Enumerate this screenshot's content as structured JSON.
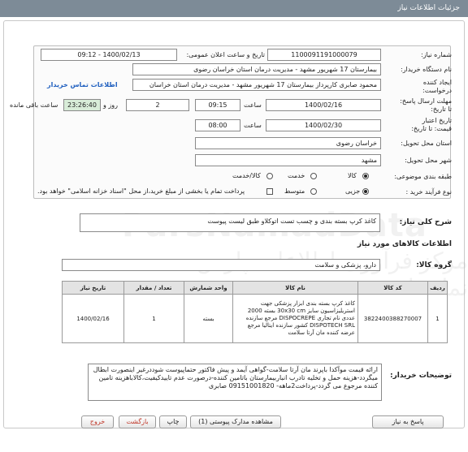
{
  "window": {
    "title": "جزئیات اطلاعات نیاز"
  },
  "header": {
    "need_number_label": "شماره نیاز:",
    "need_number": "1100091191000079",
    "announce_label": "تاریخ و ساعت اعلان عمومی:",
    "announce_value": "1400/02/13 - 09:12",
    "buyer_label": "نام دستگاه خریدار:",
    "buyer_value": "بیمارستان 17 شهریور مشهد - مدیریت درمان استان خراسان رضوی",
    "creator_label_1": "ایجاد کننده",
    "creator_label_2": "درخواست:",
    "creator_value": "محمود صابری کارپرداز بیمارستان 17 شهریور مشهد - مدیریت درمان استان خراسان",
    "contact_link": "اطلاعات تماس خریدار",
    "deadline_label_1": "مهلت ارسال پاسخ:",
    "deadline_label_2": "تا تاریخ:",
    "deadline_date": "1400/02/16",
    "time_label": "ساعت",
    "deadline_time": "09:15",
    "days_value": "2",
    "days_label": "روز و",
    "remaining_time": "23:26:40",
    "remaining_label": "ساعت باقی مانده",
    "validity_label_1": "تاریخ اعتبار",
    "validity_label_2": "قیمت: تا تاریخ:",
    "validity_date": "1400/02/30",
    "validity_time_label": "ساعت",
    "validity_time": "08:00",
    "province_label": "استان محل تحویل:",
    "province_value": "خراسان رضوی",
    "city_label": "شهر محل تحویل:",
    "city_value": "مشهد",
    "category_label": "طبقه بندی موضوعی:",
    "category_options": [
      "کالا",
      "خدمت",
      "کالا/خدمت"
    ],
    "process_label": "نوع فرآیند خرید :",
    "process_options": [
      "جزیی",
      "متوسط"
    ],
    "payment_note": "پرداخت تمام یا بخشی از مبلغ خرید،از محل \"اسناد خزانه اسلامی\" خواهد بود."
  },
  "summary": {
    "label": "شرح کلی نیاز:",
    "value": "کاغذ کرپ بسته بندی و چسب تست اتوکلاو طبق لیست پیوست"
  },
  "goods": {
    "section_title": "اطلاعات کالاهای مورد نیاز",
    "group_label": "گروه کالا:",
    "group_value": "دارو، پزشکی و سلامت",
    "columns": [
      "ردیف",
      "کد کالا",
      "نام کالا",
      "واحد شمارش",
      "تعداد / مقدار",
      "تاریخ نیاز"
    ],
    "rows": [
      {
        "index": "1",
        "code": "3822400388270007",
        "name": "کاغذ کرپ بسته بندی ابزار پزشکی جهت استریلیزاسیون سایز 30x30 cm بسته 2000 عددی نام تجاری DISPOCREPE مرجع سازنده DISPOTECH SRL کشور سازنده ایتالیا مرجع عرضه کننده مان آرتا سلامت",
        "unit": "بسته",
        "qty": "1",
        "date": "1400/02/16"
      }
    ]
  },
  "notes": {
    "label": "توضیحات خریدار:",
    "text": "ارائه قیمت موآکدا باپرند مان آرتا سلامت-گواهی آیمد و پیش فاکتور حتماپیوست شوددرغیر اینصورت ابطال میگردد-هزینه حمل و تخلیه تادرب انباربیمارستان باتامین کننده-درصورت عدم تاییدکیفیت،کالاباهزینه تامین کننده مرجوع می گردد-پرداخت2ماهه- 09151001820 صابری"
  },
  "buttons": {
    "reply": "پاسخ به نیاز",
    "docs": "مشاهده مدارک پیوستی (1)",
    "print": "چاپ",
    "back": "بازگشت",
    "exit": "خروج"
  },
  "watermark": {
    "brand": "ParsNamadData",
    "tagline": "مرکز فرآوری اطلاعات پارس نماد داده"
  }
}
